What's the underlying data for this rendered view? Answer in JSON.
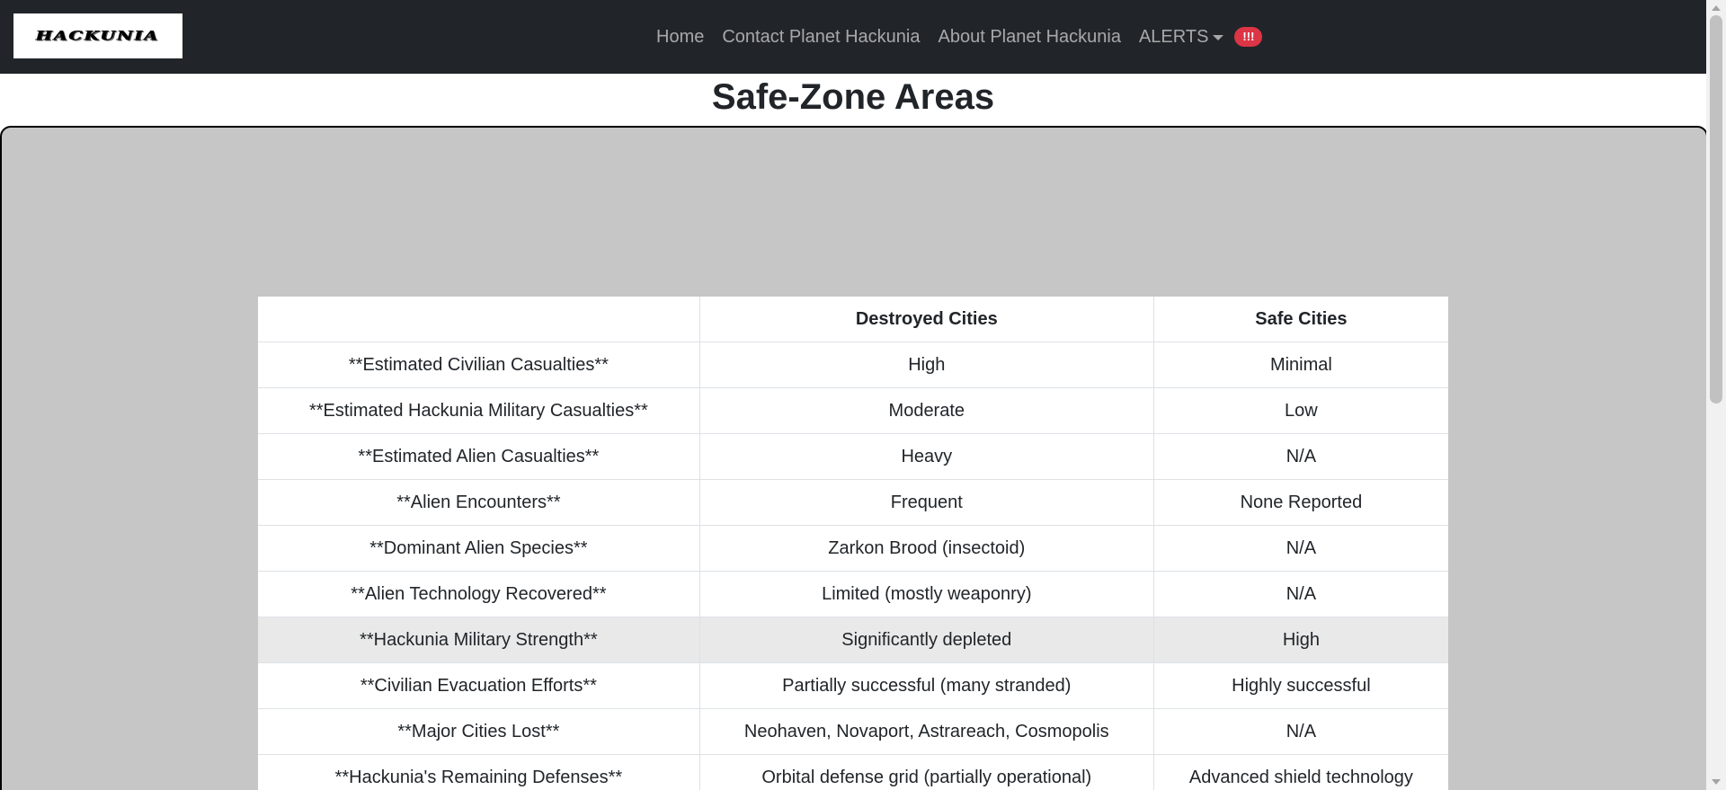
{
  "navbar": {
    "logo_text": "HACKUNIA",
    "links": [
      "Home",
      "Contact Planet Hackunia",
      "About Planet Hackunia"
    ],
    "alerts_label": "ALERTS",
    "alerts_badge": "!!!"
  },
  "page": {
    "title": "Safe-Zone Areas"
  },
  "table": {
    "headers": [
      "",
      "Destroyed Cities",
      "Safe Cities"
    ],
    "rows": [
      [
        "**Estimated Civilian Casualties**",
        "High",
        "Minimal"
      ],
      [
        "**Estimated Hackunia Military Casualties**",
        "Moderate",
        "Low"
      ],
      [
        "**Estimated Alien Casualties**",
        "Heavy",
        "N/A"
      ],
      [
        "**Alien Encounters**",
        "Frequent",
        "None Reported"
      ],
      [
        "**Dominant Alien Species**",
        "Zarkon Brood (insectoid)",
        "N/A"
      ],
      [
        "**Alien Technology Recovered**",
        "Limited (mostly weaponry)",
        "N/A"
      ],
      [
        "**Hackunia Military Strength**",
        "Significantly depleted",
        "High"
      ],
      [
        "**Civilian Evacuation Efforts**",
        "Partially successful (many stranded)",
        "Highly successful"
      ],
      [
        "**Major Cities Lost**",
        "Neohaven, Novaport, Astrareach, Cosmopolis",
        "N/A"
      ],
      [
        "**Hackunia's Remaining Defenses**",
        "Orbital defense grid (partially operational)",
        "Advanced shield technology"
      ]
    ],
    "highlighted_row": "**Hackunia Military Strength**"
  },
  "colors": {
    "navbar_bg": "#212529",
    "panel_bg": "#c6c6c6",
    "badge_bg": "#dc3545",
    "highlight_row_bg": "#e9e9e9"
  }
}
